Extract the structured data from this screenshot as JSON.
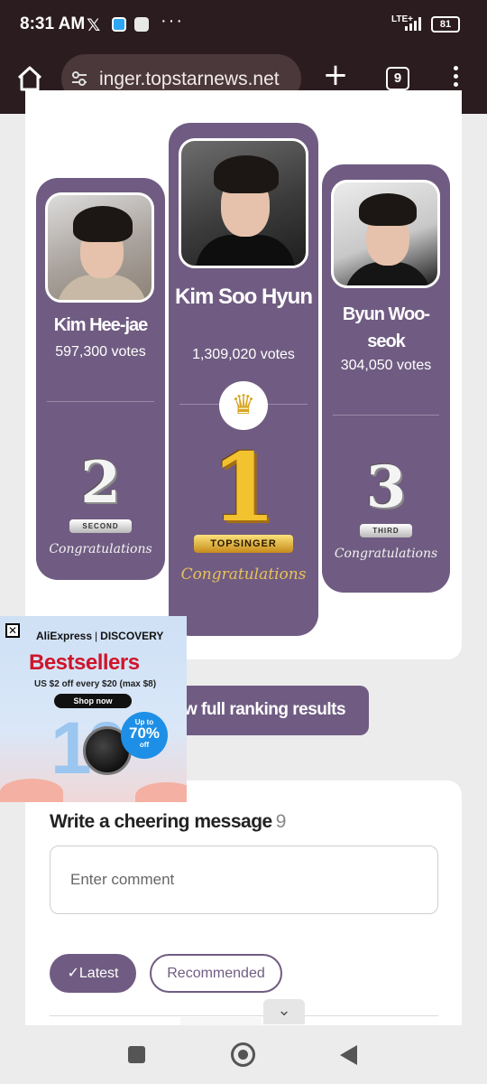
{
  "status_bar": {
    "time": "8:31 AM",
    "network": "LTE+",
    "battery": "81",
    "icons": [
      "x-icon",
      "app-icon",
      "app-icon",
      "more-dots-icon",
      "signal-icon",
      "battery-icon"
    ]
  },
  "browser": {
    "url": "inger.topstarnews.net",
    "tab_count": "9",
    "icons": [
      "home-icon",
      "tune-icon",
      "plus-icon",
      "tabs-icon",
      "menu-icon"
    ]
  },
  "ranking": {
    "first": {
      "name": "Kim Soo Hyun",
      "votes": "1,309,020 votes",
      "rank_number": "1",
      "ribbon": "TOPSINGER",
      "congrats": "Congratulations"
    },
    "second": {
      "name": "Kim Hee-jae",
      "votes": "597,300 votes",
      "rank_number": "2",
      "ribbon": "SECOND",
      "congrats": "Congratulations"
    },
    "third": {
      "name": "Byun Woo-seok",
      "votes": "304,050 votes",
      "rank_number": "3",
      "ribbon": "THIRD",
      "congrats": "Congratulations"
    },
    "full_results_label": "w full ranking results"
  },
  "cheer": {
    "title": "Write a cheering message",
    "count": "9",
    "placeholder": "Enter comment",
    "sort_latest": "✓Latest",
    "sort_recommended": "Recommended"
  },
  "ad": {
    "brand": "AliExpress",
    "brand_sub": "DISCOVERY",
    "title": "Bestsellers",
    "subtitle": "US $2 off every $20 (max $8)",
    "cta": "Shop now",
    "badge_upto": "Up to",
    "badge_pct": "70%",
    "badge_off": "off",
    "big_number": "10"
  },
  "colors": {
    "accent_purple": "#705c82",
    "browser_bar": "#2b1c1f",
    "ad_red": "#d0142a",
    "gold": "#f3c22f"
  }
}
